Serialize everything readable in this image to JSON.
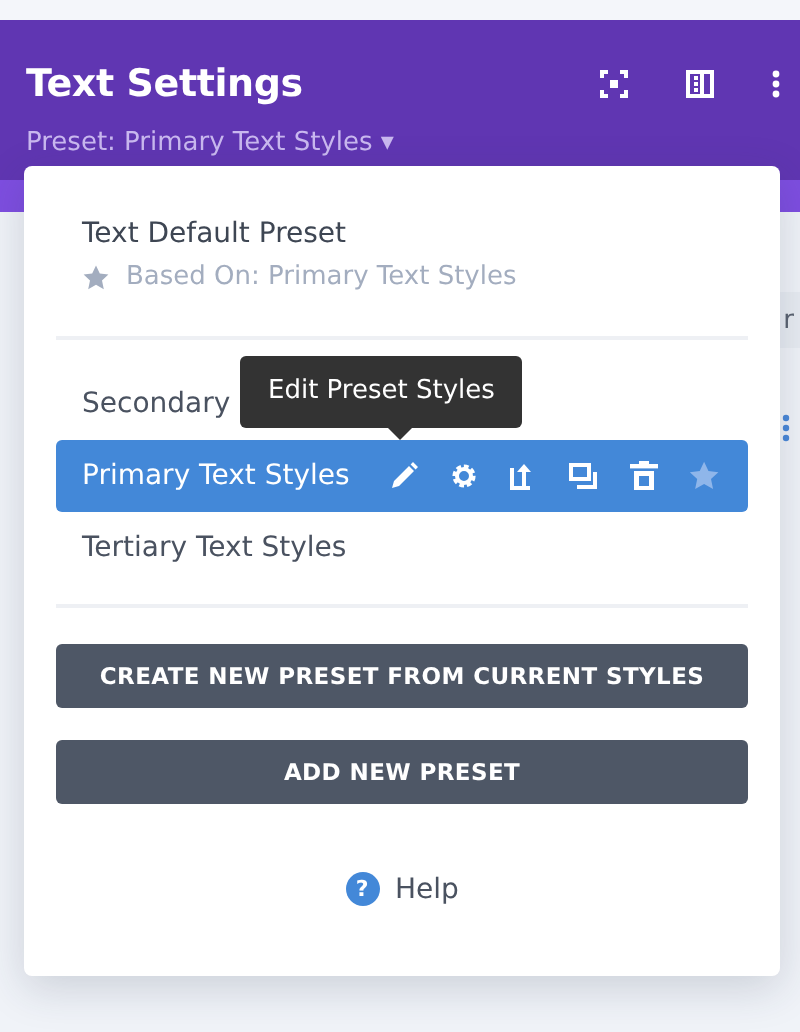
{
  "window": {
    "title": "Text Settings",
    "preset_label": "Preset: Primary Text Styles",
    "caret": "▾"
  },
  "backdrop_text": "r",
  "presets_menu": {
    "default": {
      "name": "Text Default Preset",
      "based_on": "Based On: Primary Text Styles"
    },
    "presets": [
      {
        "name": "Secondary",
        "selected": false
      },
      {
        "name": "Primary Text Styles",
        "selected": true
      },
      {
        "name": "Tertiary Text Styles",
        "selected": false
      }
    ],
    "tooltip": "Edit Preset Styles",
    "buttons": [
      "CREATE NEW PRESET FROM CURRENT STYLES",
      "ADD NEW PRESET"
    ],
    "help": {
      "icon": "?",
      "label": "Help"
    }
  }
}
